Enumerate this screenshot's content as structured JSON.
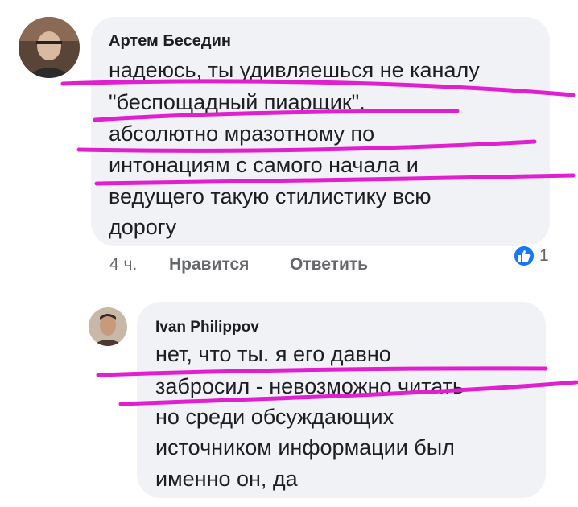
{
  "comments": [
    {
      "author": "Артем Беседин",
      "lines": [
        "надеюсь, ты удивляешься не каналу",
        "\"беспощадный пиарщик\",",
        "абсолютно мразотному по",
        "интонациям с самого начала и",
        "ведущего такую стилистику всю",
        "дорогу"
      ],
      "time": "4 ч.",
      "like_label": "Нравится",
      "reply_label": "Ответить",
      "reaction_count": "1",
      "reaction_icon": "thumbs-up-icon"
    },
    {
      "author": "Ivan Philippov",
      "lines": [
        "нет, что ты. я его давно",
        "забросил - невозможно читать",
        "но среди обсуждающих",
        "источником информации был",
        "именно он, да"
      ]
    }
  ],
  "colors": {
    "bubble": "#f0f2f5",
    "text": "#1c1e21",
    "meta": "#65676b",
    "like_blue": "#1877f2",
    "strike": "#e020d0"
  }
}
